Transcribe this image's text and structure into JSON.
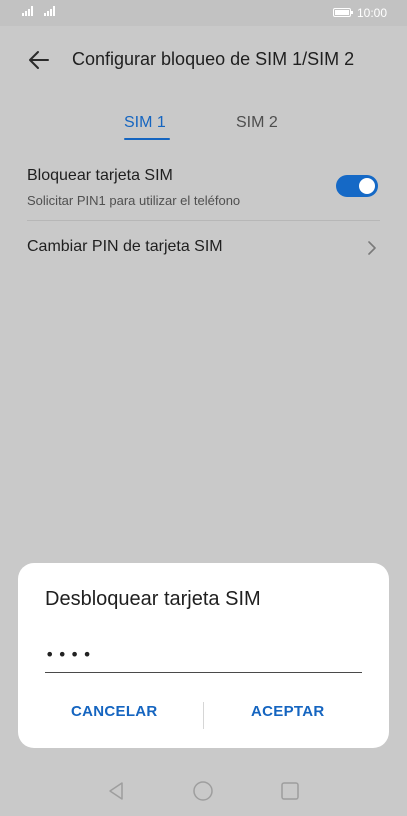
{
  "status_bar": {
    "time": "10:00"
  },
  "header": {
    "title": "Configurar bloqueo de SIM 1/SIM 2"
  },
  "tabs": [
    {
      "label": "SIM 1",
      "selected": true
    },
    {
      "label": "SIM 2",
      "selected": false
    }
  ],
  "settings": {
    "lock_sim": {
      "title": "Bloquear tarjeta SIM",
      "subtitle": "Solicitar PIN1 para utilizar el teléfono",
      "enabled": true
    },
    "change_pin": {
      "title": "Cambiar PIN de tarjeta SIM"
    }
  },
  "dialog": {
    "title": "Desbloquear tarjeta SIM",
    "pin_value": "••••",
    "cancel_label": "CANCELAR",
    "accept_label": "ACEPTAR"
  },
  "colors": {
    "accent": "#1565c0",
    "toggle_on": "#1569c6",
    "scrim_background": "#c9c9c9"
  },
  "icons": {
    "back": "arrow-left-icon",
    "chevron": "chevron-right-icon",
    "nav": [
      "triangle-back-icon",
      "circle-home-icon",
      "square-recent-icon"
    ]
  }
}
